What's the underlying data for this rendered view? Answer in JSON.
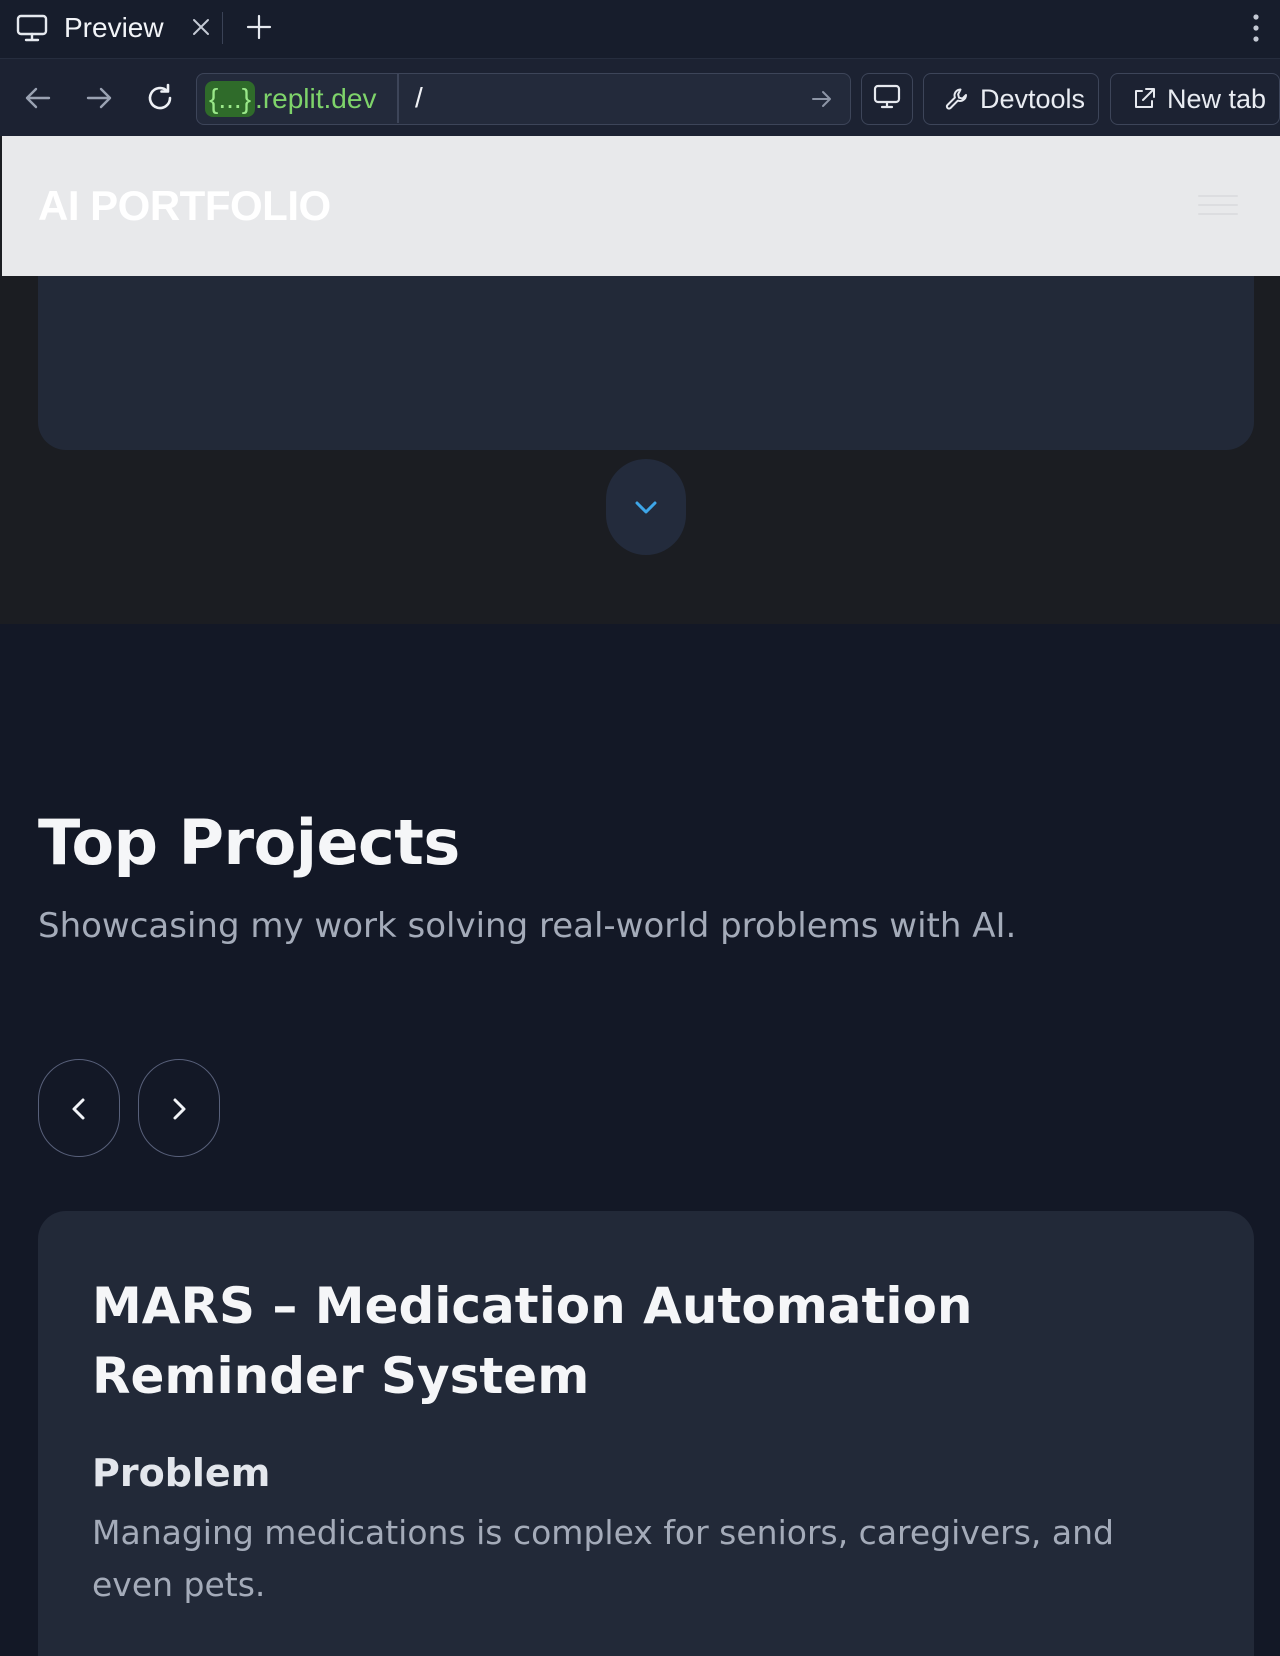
{
  "browser": {
    "tab_title": "Preview",
    "url_host_pill": "{...}",
    "url_host_rest": ".replit.dev",
    "url_path": "/",
    "devtools_label": "Devtools",
    "new_tab_label": "New tab"
  },
  "site": {
    "logo": "AI PORTFOLIO"
  },
  "projects_section": {
    "title": "Top Projects",
    "subtitle": "Showcasing my work solving real-world problems with AI."
  },
  "project": {
    "title": "MARS – Medication Automation Reminder System",
    "problem_label": "Problem",
    "problem_text": "Managing medications is complex for seniors, caregivers, and even pets."
  },
  "colors": {
    "page_background": "#131826",
    "card_background": "#222938",
    "accent_chevron": "#3ea6e8",
    "url_host_green": "#7ed36a"
  },
  "icons": [
    "monitor-icon",
    "close-icon",
    "plus-icon",
    "kebab-icon",
    "back-arrow-icon",
    "forward-arrow-icon",
    "reload-icon",
    "go-arrow-icon",
    "wrench-icon",
    "external-link-icon",
    "hamburger-icon",
    "chevron-down-icon",
    "chevron-left-icon",
    "chevron-right-icon"
  ]
}
